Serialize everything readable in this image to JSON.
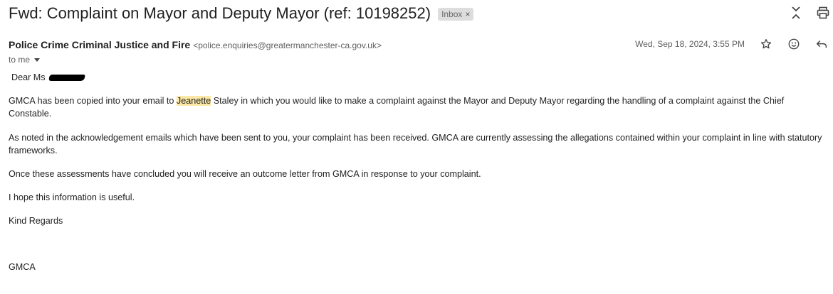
{
  "subject": "Fwd: Complaint on Mayor and Deputy Mayor (ref: 10198252)",
  "label": {
    "text": "Inbox",
    "close": "×"
  },
  "sender": {
    "name": "Police Crime Criminal Justice and Fire",
    "email": "<police.enquiries@greatermanchester-ca.gov.uk>"
  },
  "recipient": "to me",
  "date": "Wed, Sep 18, 2024, 3:55 PM",
  "icons": {
    "collapse": "collapse-all-icon",
    "print": "print-icon",
    "star": "star-icon",
    "emoji": "emoji-icon",
    "reply": "reply-icon"
  },
  "body": {
    "greeting": "Dear Ms",
    "p1_before": "GMCA has been copied into your email to ",
    "p1_highlight": "Jeanette",
    "p1_after": " Staley in which you would like to make a complaint against the Mayor and Deputy Mayor regarding the handling of a complaint against the Chief Constable.",
    "p2": "As noted in the acknowledgement emails which have been sent to you, your complaint has been received. GMCA are currently assessing the allegations contained within your complaint in line with statutory frameworks.",
    "p3": "Once these assessments have concluded you will receive an outcome letter from GMCA in response to your complaint.",
    "p4": "I hope this information is useful.",
    "p5": "Kind Regards",
    "signature": "GMCA"
  },
  "colors": {
    "highlight": "#fce8a6",
    "badge_bg": "#dddddd"
  }
}
